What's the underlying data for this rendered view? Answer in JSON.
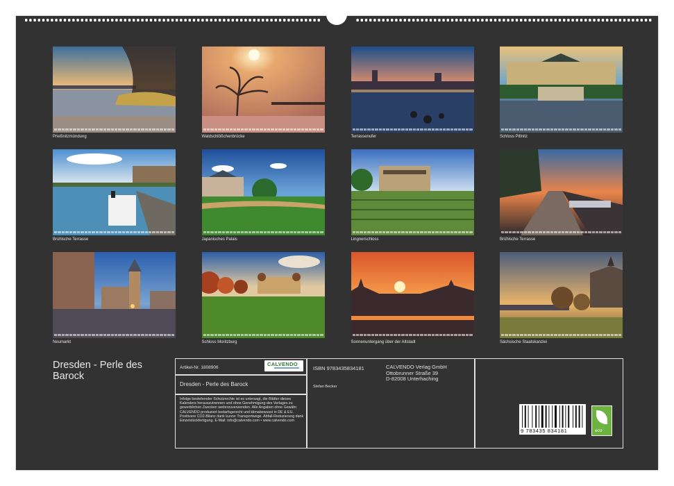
{
  "calendar": {
    "title": "Dresden - Perle des Barock",
    "thumbnails": [
      {
        "caption": "Prießnitzmündung",
        "scene": "river-trees-dusk"
      },
      {
        "caption": "Waldschlößchenbrücke",
        "scene": "foggy-tree-sun"
      },
      {
        "caption": "Terrassenufer",
        "scene": "city-night-river"
      },
      {
        "caption": "Schloss Pillnitz",
        "scene": "palace-pond"
      },
      {
        "caption": "Brühlsche Terrasse",
        "scene": "steamboat-elbe"
      },
      {
        "caption": "Japanisches Palais",
        "scene": "palace-garden"
      },
      {
        "caption": "Lingnerschloss",
        "scene": "villa-vineyard"
      },
      {
        "caption": "Brühlsche Terrasse",
        "scene": "promenade-sunset"
      },
      {
        "caption": "Neumarkt",
        "scene": "square-blue-hour"
      },
      {
        "caption": "Schloss Moritzburg",
        "scene": "castle-autumn"
      },
      {
        "caption": "Sonnenuntergang über der Altstadt",
        "scene": "red-sunset-skyline"
      },
      {
        "caption": "Sächsische Staatskanzlei",
        "scene": "autumn-river-skyline"
      }
    ],
    "info": {
      "article_label": "Artikel-Nr. 1808906",
      "brand": "CALVENDO",
      "product_title": "Dresden - Perle des Barock",
      "isbn": "ISBN 9783435834181",
      "author": "Stefan Becker",
      "publisher_lines": [
        "CALVENDO Verlag GmbH",
        "Ottobrunner Straße 39",
        "D-82008 Unterhaching"
      ],
      "legal": "Infolge bestehender Schutzrechte ist es untersagt, die Blätter dieses Kalenders herauszutrennen und ohne Genehmigung des Verlages zu gewerblichen Zwecken weiterzuverwenden. Alle Angaben ohne Gewähr. CALVENDO produziert bedarfsgerecht und klimabewusst in DE & EU. Positivere CO2-Bilanz dank kurzer Transportwege. Abfall-Reduzierung dank Einzelstückfertigung. E-Mail: info@calvendo.com • www.calvendo.com",
      "barcode_number": "9 783435 834181",
      "eco_label": "eco"
    }
  }
}
